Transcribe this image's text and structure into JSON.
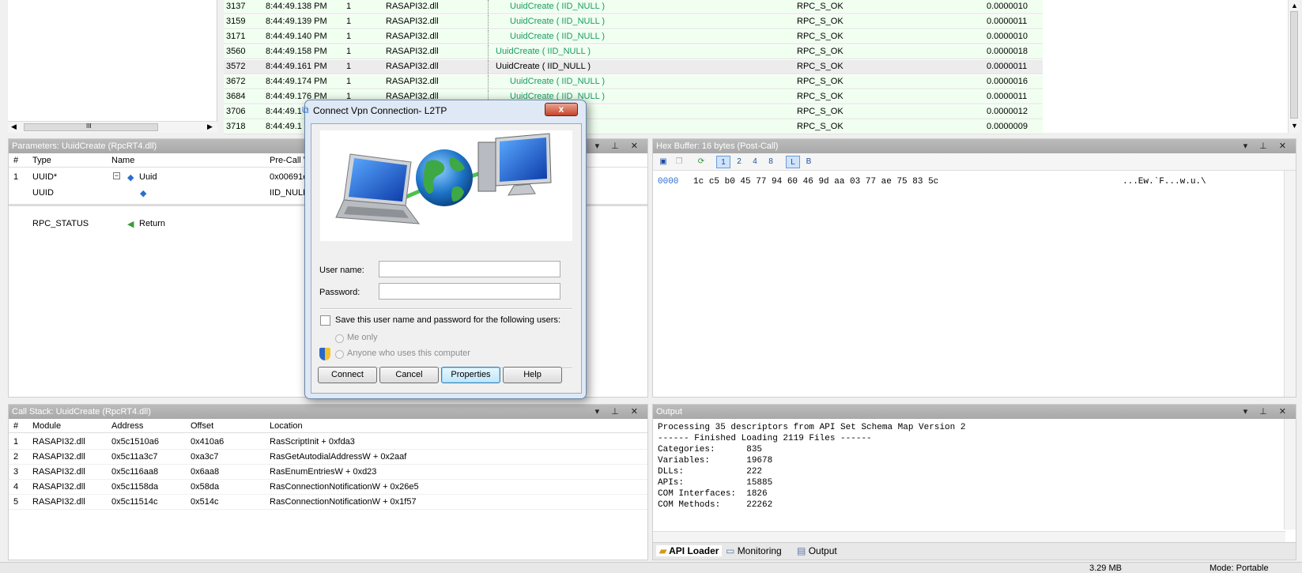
{
  "trace": {
    "rows": [
      {
        "seq": "3137",
        "time": "8:44:49.138 PM",
        "thread": "1",
        "module": "RASAPI32.dll",
        "api": "UuidCreate ( IID_NULL )",
        "result": "RPC_S_OK",
        "duration": "0.0000010",
        "nested": true,
        "selected": false
      },
      {
        "seq": "3159",
        "time": "8:44:49.139 PM",
        "thread": "1",
        "module": "RASAPI32.dll",
        "api": "UuidCreate ( IID_NULL )",
        "result": "RPC_S_OK",
        "duration": "0.0000011",
        "nested": true,
        "selected": false
      },
      {
        "seq": "3171",
        "time": "8:44:49.140 PM",
        "thread": "1",
        "module": "RASAPI32.dll",
        "api": "UuidCreate ( IID_NULL )",
        "result": "RPC_S_OK",
        "duration": "0.0000010",
        "nested": true,
        "selected": false
      },
      {
        "seq": "3560",
        "time": "8:44:49.158 PM",
        "thread": "1",
        "module": "RASAPI32.dll",
        "api": "UuidCreate ( IID_NULL )",
        "result": "RPC_S_OK",
        "duration": "0.0000018",
        "nested": false,
        "selected": false
      },
      {
        "seq": "3572",
        "time": "8:44:49.161 PM",
        "thread": "1",
        "module": "RASAPI32.dll",
        "api": "UuidCreate ( IID_NULL )",
        "result": "RPC_S_OK",
        "duration": "0.0000011",
        "nested": false,
        "selected": true
      },
      {
        "seq": "3672",
        "time": "8:44:49.174 PM",
        "thread": "1",
        "module": "RASAPI32.dll",
        "api": "UuidCreate ( IID_NULL )",
        "result": "RPC_S_OK",
        "duration": "0.0000016",
        "nested": true,
        "selected": false
      },
      {
        "seq": "3684",
        "time": "8:44:49.176 PM",
        "thread": "1",
        "module": "RASAPI32.dll",
        "api": "UuidCreate ( IID_NULL )",
        "result": "RPC_S_OK",
        "duration": "0.0000011",
        "nested": true,
        "selected": false
      },
      {
        "seq": "3706",
        "time": "8:44:49.1",
        "thread": "1",
        "module": "RASAPI32.dll",
        "api": "",
        "result": "RPC_S_OK",
        "duration": "0.0000012",
        "nested": true,
        "selected": false
      },
      {
        "seq": "3718",
        "time": "8:44:49.1",
        "thread": "1",
        "module": "RASAPI32.dll",
        "api": "",
        "result": "RPC_S_OK",
        "duration": "0.0000009",
        "nested": true,
        "selected": false
      }
    ],
    "scroll_mark": "III"
  },
  "params": {
    "title": "Parameters: UuidCreate (RpcRT4.dll)",
    "columns": [
      "#",
      "Type",
      "Name",
      "Pre-Call V"
    ],
    "rows": [
      {
        "num": "1",
        "type": "UUID*",
        "name": "Uuid",
        "value": "0x00691e"
      },
      {
        "num": "",
        "type": "UUID",
        "name": "",
        "value": "IID_NULL"
      }
    ],
    "return_row": {
      "type": "RPC_STATUS",
      "name": "Return"
    }
  },
  "hex": {
    "title": "Hex Buffer: 16 bytes (Post-Call)",
    "toolbar": [
      "1",
      "2",
      "4",
      "8",
      "L",
      "B"
    ],
    "offset": "0000",
    "bytes": "1c c5 b0 45 77 94 60 46 9d aa 03 77 ae 75 83 5c",
    "ascii": "...Ew.`F...w.u.\\"
  },
  "callstack": {
    "title": "Call Stack: UuidCreate (RpcRT4.dll)",
    "columns": [
      "#",
      "Module",
      "Address",
      "Offset",
      "Location"
    ],
    "rows": [
      {
        "num": "1",
        "module": "RASAPI32.dll",
        "address": "0x5c1510a6",
        "offset": "0x410a6",
        "location": "RasScriptInit + 0xfda3"
      },
      {
        "num": "2",
        "module": "RASAPI32.dll",
        "address": "0x5c11a3c7",
        "offset": "0xa3c7",
        "location": "RasGetAutodialAddressW + 0x2aaf"
      },
      {
        "num": "3",
        "module": "RASAPI32.dll",
        "address": "0x5c116aa8",
        "offset": "0x6aa8",
        "location": "RasEnumEntriesW + 0xd23"
      },
      {
        "num": "4",
        "module": "RASAPI32.dll",
        "address": "0x5c1158da",
        "offset": "0x58da",
        "location": "RasConnectionNotificationW + 0x26e5"
      },
      {
        "num": "5",
        "module": "RASAPI32.dll",
        "address": "0x5c11514c",
        "offset": "0x514c",
        "location": "RasConnectionNotificationW + 0x1f57"
      }
    ]
  },
  "output": {
    "title": "Output",
    "lines": [
      "Processing 35 descriptors from API Set Schema Map Version 2",
      "------ Finished Loading 2119 Files ------",
      "Categories:      835",
      "Variables:       19678",
      "DLLs:            222",
      "APIs:            15885",
      "COM Interfaces:  1826",
      "COM Methods:     22262"
    ],
    "tabs": [
      "API Loader",
      "Monitoring",
      "Output"
    ]
  },
  "status": {
    "memory": "3.29 MB",
    "mode": "Mode: Portable"
  },
  "dialog": {
    "title": "Connect Vpn Connection- L2TP",
    "close_label": "x",
    "username_label": "User name:",
    "username_value": "",
    "password_label": "Password:",
    "password_value": "",
    "save_label": "Save this user name and password for the following users:",
    "me_only_label": "Me only",
    "anyone_label": "Anyone who uses this computer",
    "buttons": {
      "connect": "Connect",
      "cancel": "Cancel",
      "properties": "Properties",
      "help": "Help"
    }
  }
}
